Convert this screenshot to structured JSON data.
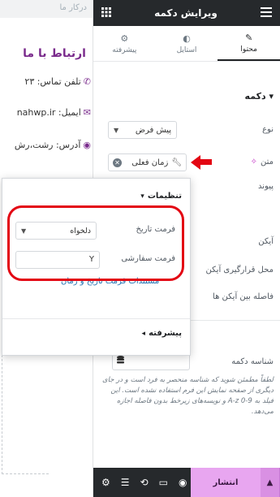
{
  "canvas": {
    "search_text": "درکار ما",
    "contact_title": "ارتباط با ما",
    "phone_text": "تلفن تماس: ۲۳",
    "email_text": "ایمیل: nahwp.ir",
    "address_text": "آدرس: رشت،رش"
  },
  "topbar": {
    "title": "ویرایش دکمه"
  },
  "tabs": [
    {
      "label": "محتوا",
      "icon": "pencil-icon"
    },
    {
      "label": "استایل",
      "icon": "half-circle-icon"
    },
    {
      "label": "پیشرفته",
      "icon": "gear-icon"
    }
  ],
  "section": {
    "title": "دکمه"
  },
  "controls": {
    "type_label": "نوع",
    "type_value": "پیش فرض",
    "text_label": "متن",
    "text_dynamic_value": "زمان فعلی",
    "link_label": "پیوند",
    "link_value": "#",
    "icon_label": "آیکن",
    "icon_position_label": "محل قرارگیری آیکن",
    "icon_spacing_label": "فاصله بین آیکن ها",
    "button_id_label": "شناسه دکمه",
    "help_text": "لطفاً مطمئن شوید که شناسه منحصر به فرد است و در جای دیگری از صفحه نمایش این فرم استفاده نشده است. این فیلد به ‎A-z ‎0-9 و نویسه‌های زیرخط بدون فاصله اجازه می‌دهد."
  },
  "popover": {
    "title": "تنظیمات",
    "date_format_label": "فرمت تاریخ",
    "date_format_value": "دلخواه",
    "custom_format_label": "فرمت سفارشی",
    "custom_format_value": "Y",
    "docs_link": "مستندات فرمت تاریخ و زمان",
    "advanced_label": "پیشرفته"
  },
  "footer": {
    "publish_label": "انتشار"
  },
  "colors": {
    "accent_purple": "#7a2b8c",
    "highlight_red": "#e30613",
    "publish_pink": "#e8a6f0",
    "dark_bar": "#26292c"
  }
}
